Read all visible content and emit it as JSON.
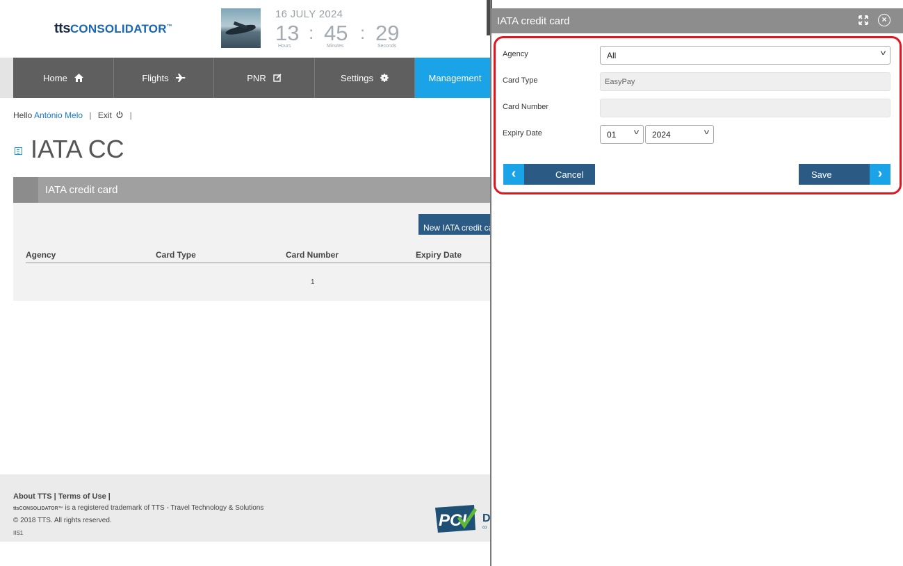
{
  "brand": {
    "tts": "tts",
    "name": "CONSOLIDATOR",
    "tm": "™"
  },
  "clock": {
    "date": "16 JULY 2024",
    "hours": "13",
    "minutes": "45",
    "seconds": "29",
    "separator": ":",
    "hours_label": "Hours",
    "minutes_label": "Minutes",
    "seconds_label": "Seconds"
  },
  "nav": {
    "items": [
      {
        "label": "Home",
        "icon": "home-icon"
      },
      {
        "label": "Flights",
        "icon": "airplane-icon"
      },
      {
        "label": "PNR",
        "icon": "edit-icon"
      },
      {
        "label": "Settings",
        "icon": "gear-icon"
      },
      {
        "label": "Management",
        "icon": ""
      }
    ],
    "active": "Management"
  },
  "user_bar": {
    "hello": "Hello",
    "user": "António Melo",
    "divider": "|",
    "exit": "Exit"
  },
  "page": {
    "title": "IATA CC"
  },
  "section": {
    "title": "IATA credit card",
    "new_button": "New IATA credit card",
    "columns": [
      "Agency",
      "Card Type",
      "Card Number",
      "Expiry Date"
    ],
    "page_number": "1"
  },
  "footer": {
    "about": "About TTS",
    "terms": "Terms of Use",
    "divider": "|",
    "trademark_brand": "ttsCONSOLIDATOR™",
    "trademark": "is a registered trademark of TTS - Travel Technology & Solutions",
    "copyright": "© 2018 TTS. All rights reserved.",
    "server": "IIS1",
    "badge": "PCI",
    "badge_letter": "D",
    "badge_sub": "co"
  },
  "modal": {
    "title": "IATA credit card",
    "fields": {
      "agency_label": "Agency",
      "agency_value": "All",
      "card_type_label": "Card Type",
      "card_type_value": "EasyPay",
      "card_number_label": "Card Number",
      "card_number_value": "",
      "expiry_label": "Expiry Date",
      "expiry_month": "01",
      "expiry_year": "2024"
    },
    "cancel": "Cancel",
    "save": "Save"
  },
  "colors": {
    "nav_bg": "#5f5f5f",
    "nav_active": "#1aa3e6",
    "button_bg": "#2b5b84",
    "header_gray": "#8d8d8d",
    "highlight_red": "#e0161f",
    "link_blue": "#1a7ac4"
  }
}
